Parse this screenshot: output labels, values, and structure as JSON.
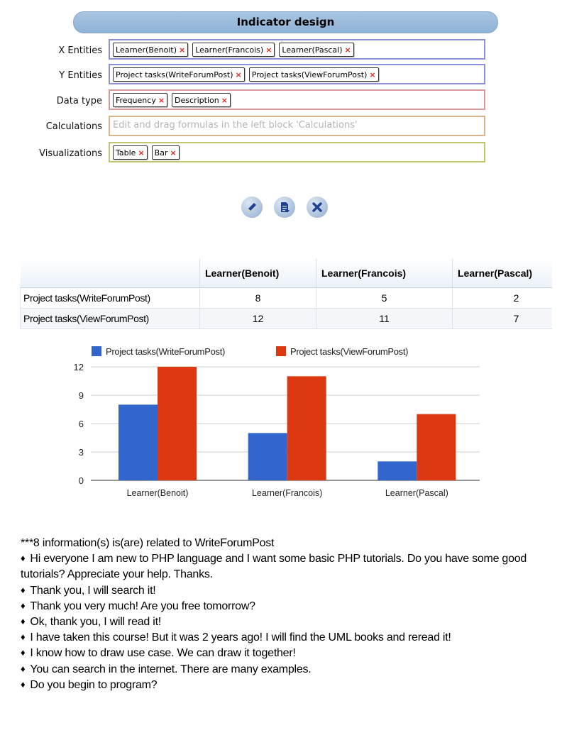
{
  "panel": {
    "title": "Indicator design",
    "rows": [
      {
        "label": "X Entities",
        "chips": [
          "Learner(Benoit)",
          "Learner(Francois)",
          "Learner(Pascal)"
        ]
      },
      {
        "label": "Y Entities",
        "chips": [
          "Project tasks(WriteForumPost)",
          "Project tasks(ViewForumPost)"
        ]
      },
      {
        "label": "Data type",
        "chips": [
          "Frequency",
          "Description"
        ]
      },
      {
        "label": "Calculations",
        "placeholder": "Edit and drag formulas in the left block 'Calculations'"
      },
      {
        "label": "Visualizations",
        "chips": [
          "Table",
          "Bar"
        ]
      }
    ],
    "chip_remove_symbol": "×"
  },
  "actions": [
    "pencil-icon",
    "document-icon",
    "close-icon"
  ],
  "table": {
    "headers": [
      "Learner(Benoit)",
      "Learner(Francois)",
      "Learner(Pascal)"
    ],
    "rows": [
      {
        "label": "Project tasks(WriteForumPost)",
        "values": [
          "8",
          "5",
          "2"
        ]
      },
      {
        "label": "Project tasks(ViewForumPost)",
        "values": [
          "12",
          "11",
          "7"
        ]
      }
    ]
  },
  "chart_data": {
    "type": "bar",
    "categories": [
      "Learner(Benoit)",
      "Learner(Francois)",
      "Learner(Pascal)"
    ],
    "series": [
      {
        "name": "Project tasks(WriteForumPost)",
        "values": [
          8,
          5,
          2
        ],
        "color": "#3366cc"
      },
      {
        "name": "Project tasks(ViewForumPost)",
        "values": [
          12,
          11,
          7
        ],
        "color": "#dc3912"
      }
    ],
    "ylim": [
      0,
      12
    ],
    "yticks": [
      0,
      3,
      6,
      9,
      12
    ],
    "grid": true,
    "legend": "top"
  },
  "info": {
    "lead": "***8 information(s) is(are) related to WriteForumPost",
    "items": [
      "Hi everyone I am new to PHP language and I want some basic PHP tutorials. Do you have some good tutorials? Appreciate your help. Thanks.",
      "Thank you, I will search it!",
      "Thank you very much! Are you free tomorrow?",
      "Ok, thank you, I will read it!",
      "I have taken this course!  But it was 2 years ago! I will find the UML books and reread it!",
      "I know how to draw use case. We can draw it together!",
      "You can search in the internet. There are many examples.",
      "Do you begin to program?"
    ]
  }
}
